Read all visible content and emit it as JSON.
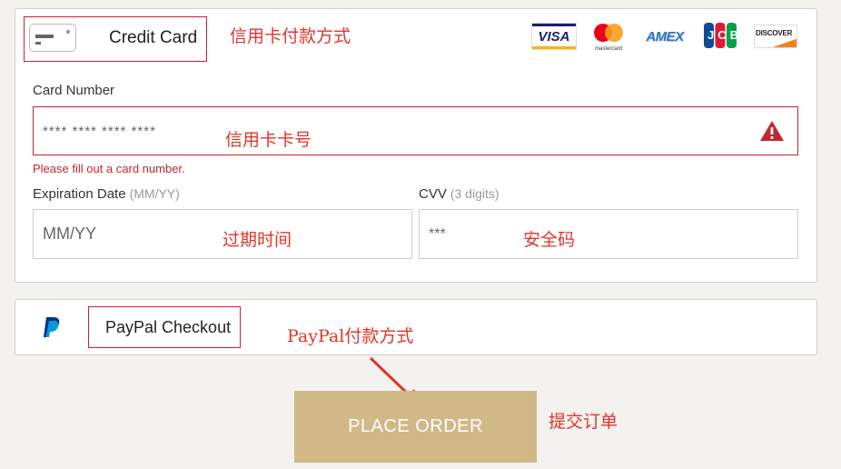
{
  "credit_card": {
    "label": "Credit Card",
    "annotation": "信用卡付款方式",
    "brands": [
      "visa",
      "mastercard",
      "amex",
      "jcb",
      "discover"
    ],
    "brand_text": {
      "visa": "VISA",
      "mastercard_caption": "mastercard",
      "amex": "AMEX",
      "jcb": "JCB",
      "discover": "DISCOVER"
    },
    "card_number": {
      "label": "Card Number",
      "placeholder": "**** **** **** ****",
      "annotation": "信用卡卡号",
      "error": "Please fill out a card number."
    },
    "expiration": {
      "label": "Expiration Date",
      "hint": "(MM/YY)",
      "placeholder": "MM/YY",
      "annotation": "过期时间"
    },
    "cvv": {
      "label": "CVV",
      "hint": "(3 digits)",
      "placeholder": "***",
      "annotation": "安全码"
    }
  },
  "paypal": {
    "label": "PayPal Checkout",
    "annotation": "PayPal付款方式"
  },
  "order": {
    "button_label": "PLACE ORDER",
    "annotation": "提交订单"
  },
  "colors": {
    "annotation_red": "#e0352b",
    "button_gold": "#d0b887",
    "error_red": "#c0282d"
  }
}
